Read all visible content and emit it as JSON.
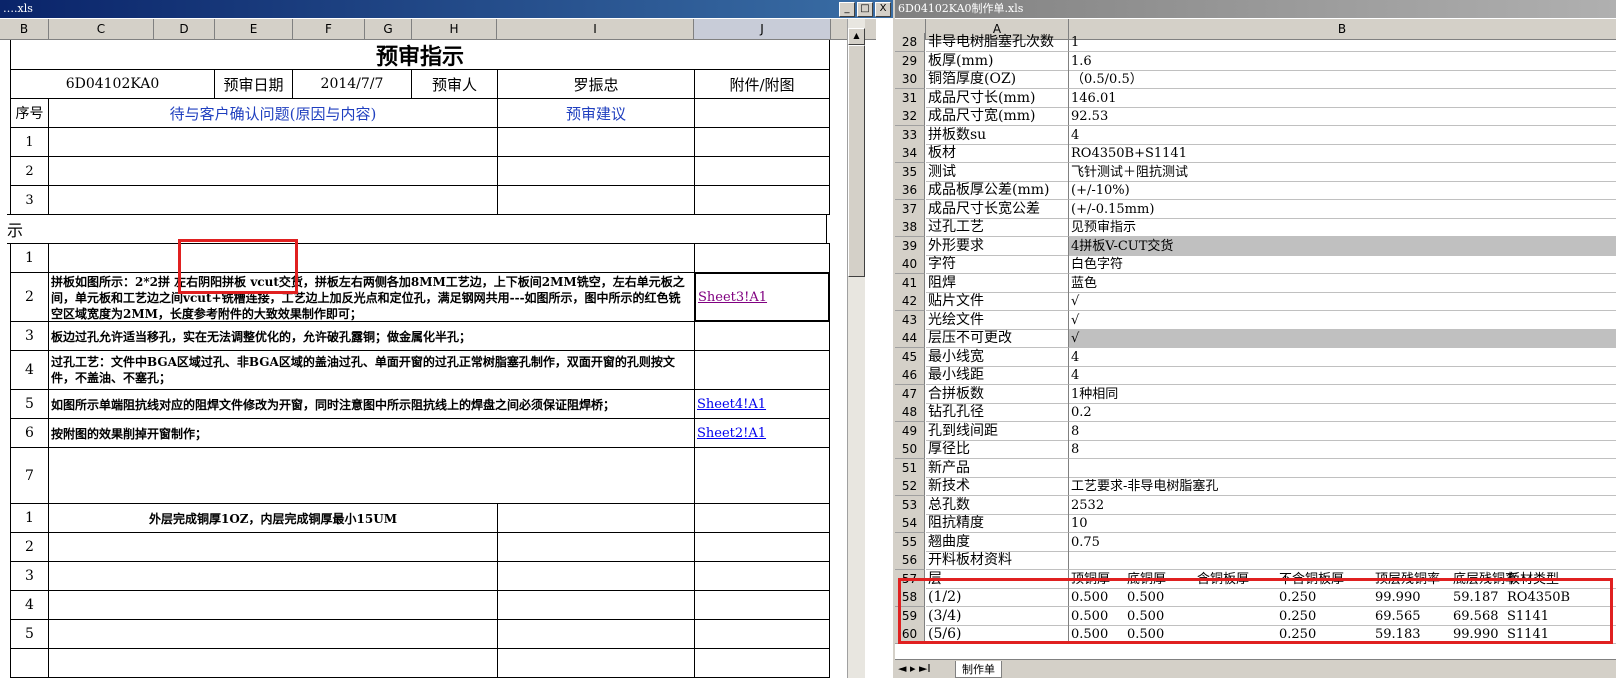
{
  "left_window": {
    "title": "….xls",
    "win_buttons": [
      "_",
      "□",
      "X"
    ],
    "columns": [
      "B",
      "C",
      "D",
      "E",
      "F",
      "G",
      "H",
      "I",
      "J"
    ],
    "sheet_title": "预审指示",
    "header_row": {
      "part_no": "6D04102KA0",
      "date_label": "预审日期",
      "date_value": "2014/7/7",
      "reviewer_label": "预审人",
      "reviewer_value": "罗振忠",
      "attachment_label": "附件/附图"
    },
    "question_header": {
      "seq": "序号",
      "issue": "待与客户确认问题(原因与内容)",
      "suggestion": "预审建议"
    },
    "question_rows": [
      "1",
      "2",
      "3"
    ],
    "section_fragment": "示",
    "instructions": [
      {
        "seq": "1",
        "text": "",
        "link": ""
      },
      {
        "seq": "2",
        "text": "拼板如图所示：2*2拼 左右阴阳拼板 vcut交货，拼板左右两侧各加8MM工艺边，上下板间2MM铣空，左右单元板之间，单元板和工艺边之间vcut+铣槽连接，工艺边上加反光点和定位孔，满足钢网共用---如图所示，图中所示的红色铣空区域宽度为2MM，长度参考附件的大致效果制作即可；",
        "link": "Sheet3!A1"
      },
      {
        "seq": "3",
        "text": "板边过孔允许适当移孔，实在无法调整优化的，允许破孔露铜；做金属化半孔；",
        "link": ""
      },
      {
        "seq": "4",
        "text": "过孔工艺：文件中BGA区域过孔、非BGA区域的盖油过孔、单面开窗的过孔正常树脂塞孔制作，双面开窗的孔则按文件，不盖油、不塞孔；",
        "link": ""
      },
      {
        "seq": "5",
        "text": "如图所示单端阻抗线对应的阻焊文件修改为开窗，同时注意图中所示阻抗线上的焊盘之间必须保证阻焊桥；",
        "link": "Sheet4!A1"
      },
      {
        "seq": "6",
        "text": "按附图的效果削掉开窗制作；",
        "link": "Sheet2!A1"
      },
      {
        "seq": "7",
        "text": "",
        "link": ""
      }
    ],
    "lower_rows": [
      {
        "seq": "1",
        "text": "外层完成铜厚1OZ，内层完成铜厚最小15UM"
      },
      {
        "seq": "2",
        "text": ""
      },
      {
        "seq": "3",
        "text": ""
      },
      {
        "seq": "4",
        "text": ""
      },
      {
        "seq": "5",
        "text": ""
      }
    ]
  },
  "right_window": {
    "title": "6D04102KA0制作单.xls",
    "columns": [
      "A",
      "B"
    ],
    "rows": [
      {
        "n": "28",
        "a": "非导电树脂塞孔次数",
        "b": "1"
      },
      {
        "n": "29",
        "a": "板厚(mm)",
        "b": "1.6"
      },
      {
        "n": "30",
        "a": "铜箔厚度(OZ)",
        "b": "（0.5/0.5）"
      },
      {
        "n": "31",
        "a": "成品尺寸长(mm)",
        "b": "146.01"
      },
      {
        "n": "32",
        "a": "成品尺寸宽(mm)",
        "b": "92.53"
      },
      {
        "n": "33",
        "a": "拼板数su",
        "b": "4"
      },
      {
        "n": "34",
        "a": "板材",
        "b": "RO4350B+S1141"
      },
      {
        "n": "35",
        "a": "测试",
        "b": "飞针测试＋阻抗测试"
      },
      {
        "n": "36",
        "a": "成品板厚公差(mm)",
        "b": "(+/-10%)"
      },
      {
        "n": "37",
        "a": "成品尺寸长宽公差",
        "b": "(+/-0.15mm)"
      },
      {
        "n": "38",
        "a": "过孔工艺",
        "b": "见预审指示"
      },
      {
        "n": "39",
        "a": "外形要求",
        "b": "4拼板V-CUT交货",
        "gray": true
      },
      {
        "n": "40",
        "a": "字符",
        "b": "白色字符"
      },
      {
        "n": "41",
        "a": "阻焊",
        "b": "蓝色"
      },
      {
        "n": "42",
        "a": "贴片文件",
        "b": "√"
      },
      {
        "n": "43",
        "a": "光绘文件",
        "b": "√"
      },
      {
        "n": "44",
        "a": "层压不可更改",
        "b": "√",
        "gray": true
      },
      {
        "n": "45",
        "a": "最小线宽",
        "b": "4"
      },
      {
        "n": "46",
        "a": "最小线距",
        "b": "4"
      },
      {
        "n": "47",
        "a": "合拼板数",
        "b": "1种相同"
      },
      {
        "n": "48",
        "a": "钻孔孔径",
        "b": "0.2"
      },
      {
        "n": "49",
        "a": "孔到线间距",
        "b": "8"
      },
      {
        "n": "50",
        "a": "厚径比",
        "b": "8"
      },
      {
        "n": "51",
        "a": "新产品",
        "b": ""
      },
      {
        "n": "52",
        "a": "新技术",
        "b": "工艺要求-非导电树脂塞孔"
      },
      {
        "n": "53",
        "a": "总孔数",
        "b": "2532"
      },
      {
        "n": "54",
        "a": "阻抗精度",
        "b": "10"
      },
      {
        "n": "55",
        "a": "翘曲度",
        "b": "0.75"
      },
      {
        "n": "56",
        "a": "开料板材资料",
        "b": ""
      }
    ],
    "layer_header": {
      "n": "57",
      "a": "层",
      "cols": [
        "顶铜厚",
        "底铜厚",
        "含铜板厚",
        "不含铜板厚",
        "顶层残铜率",
        "底层残铜率",
        "板材类型"
      ]
    },
    "layer_rows": [
      {
        "n": "58",
        "a": "(1/2)",
        "cols": [
          "0.500",
          "0.500",
          "",
          "0.250",
          "99.990",
          "59.187",
          "RO4350B"
        ]
      },
      {
        "n": "59",
        "a": "(3/4)",
        "cols": [
          "0.500",
          "0.500",
          "",
          "0.250",
          "69.565",
          "69.568",
          "S1141"
        ]
      },
      {
        "n": "60",
        "a": "(5/6)",
        "cols": [
          "0.500",
          "0.500",
          "",
          "0.250",
          "59.183",
          "99.990",
          "S1141"
        ]
      }
    ],
    "sheet_tab": "制作单"
  },
  "colors": {
    "highlight_box": "#e02020",
    "link": "#0000ee",
    "visited_link": "#800080",
    "header_blue": "#1f3fbf"
  }
}
